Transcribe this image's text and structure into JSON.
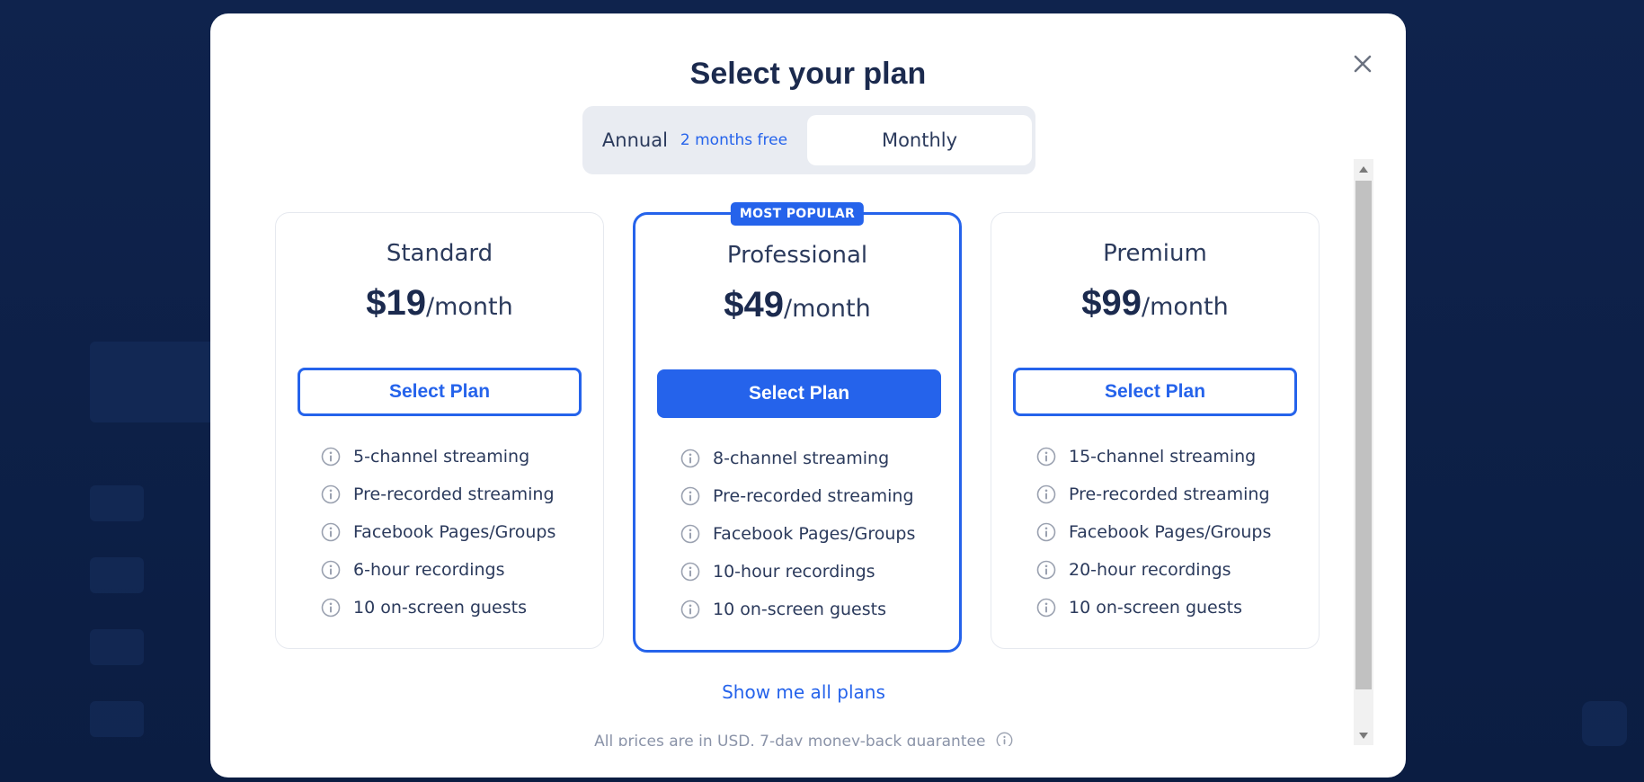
{
  "modal": {
    "title": "Select your plan",
    "close_icon": "close-icon"
  },
  "billing_toggle": {
    "annual_label": "Annual",
    "annual_promo": "2 months free",
    "monthly_label": "Monthly",
    "selected": "Monthly"
  },
  "plans": [
    {
      "name": "Standard",
      "price": "$19",
      "period": "/month",
      "button": "Select Plan",
      "featured": false,
      "features": [
        "5-channel streaming",
        "Pre-recorded streaming",
        "Facebook Pages/Groups",
        "6-hour recordings",
        "10 on-screen guests"
      ]
    },
    {
      "name": "Professional",
      "price": "$49",
      "period": "/month",
      "button": "Select Plan",
      "featured": true,
      "badge": "MOST POPULAR",
      "features": [
        "8-channel streaming",
        "Pre-recorded streaming",
        "Facebook Pages/Groups",
        "10-hour recordings",
        "10 on-screen guests"
      ]
    },
    {
      "name": "Premium",
      "price": "$99",
      "period": "/month",
      "button": "Select Plan",
      "featured": false,
      "features": [
        "15-channel streaming",
        "Pre-recorded streaming",
        "Facebook Pages/Groups",
        "20-hour recordings",
        "10 on-screen guests"
      ]
    }
  ],
  "show_all_link": "Show me all plans",
  "footer_note": "All prices are in USD. 7-day money-back guarantee",
  "colors": {
    "accent": "#2563eb",
    "heading": "#1b2a4e",
    "backdrop": "#0d1f45"
  }
}
